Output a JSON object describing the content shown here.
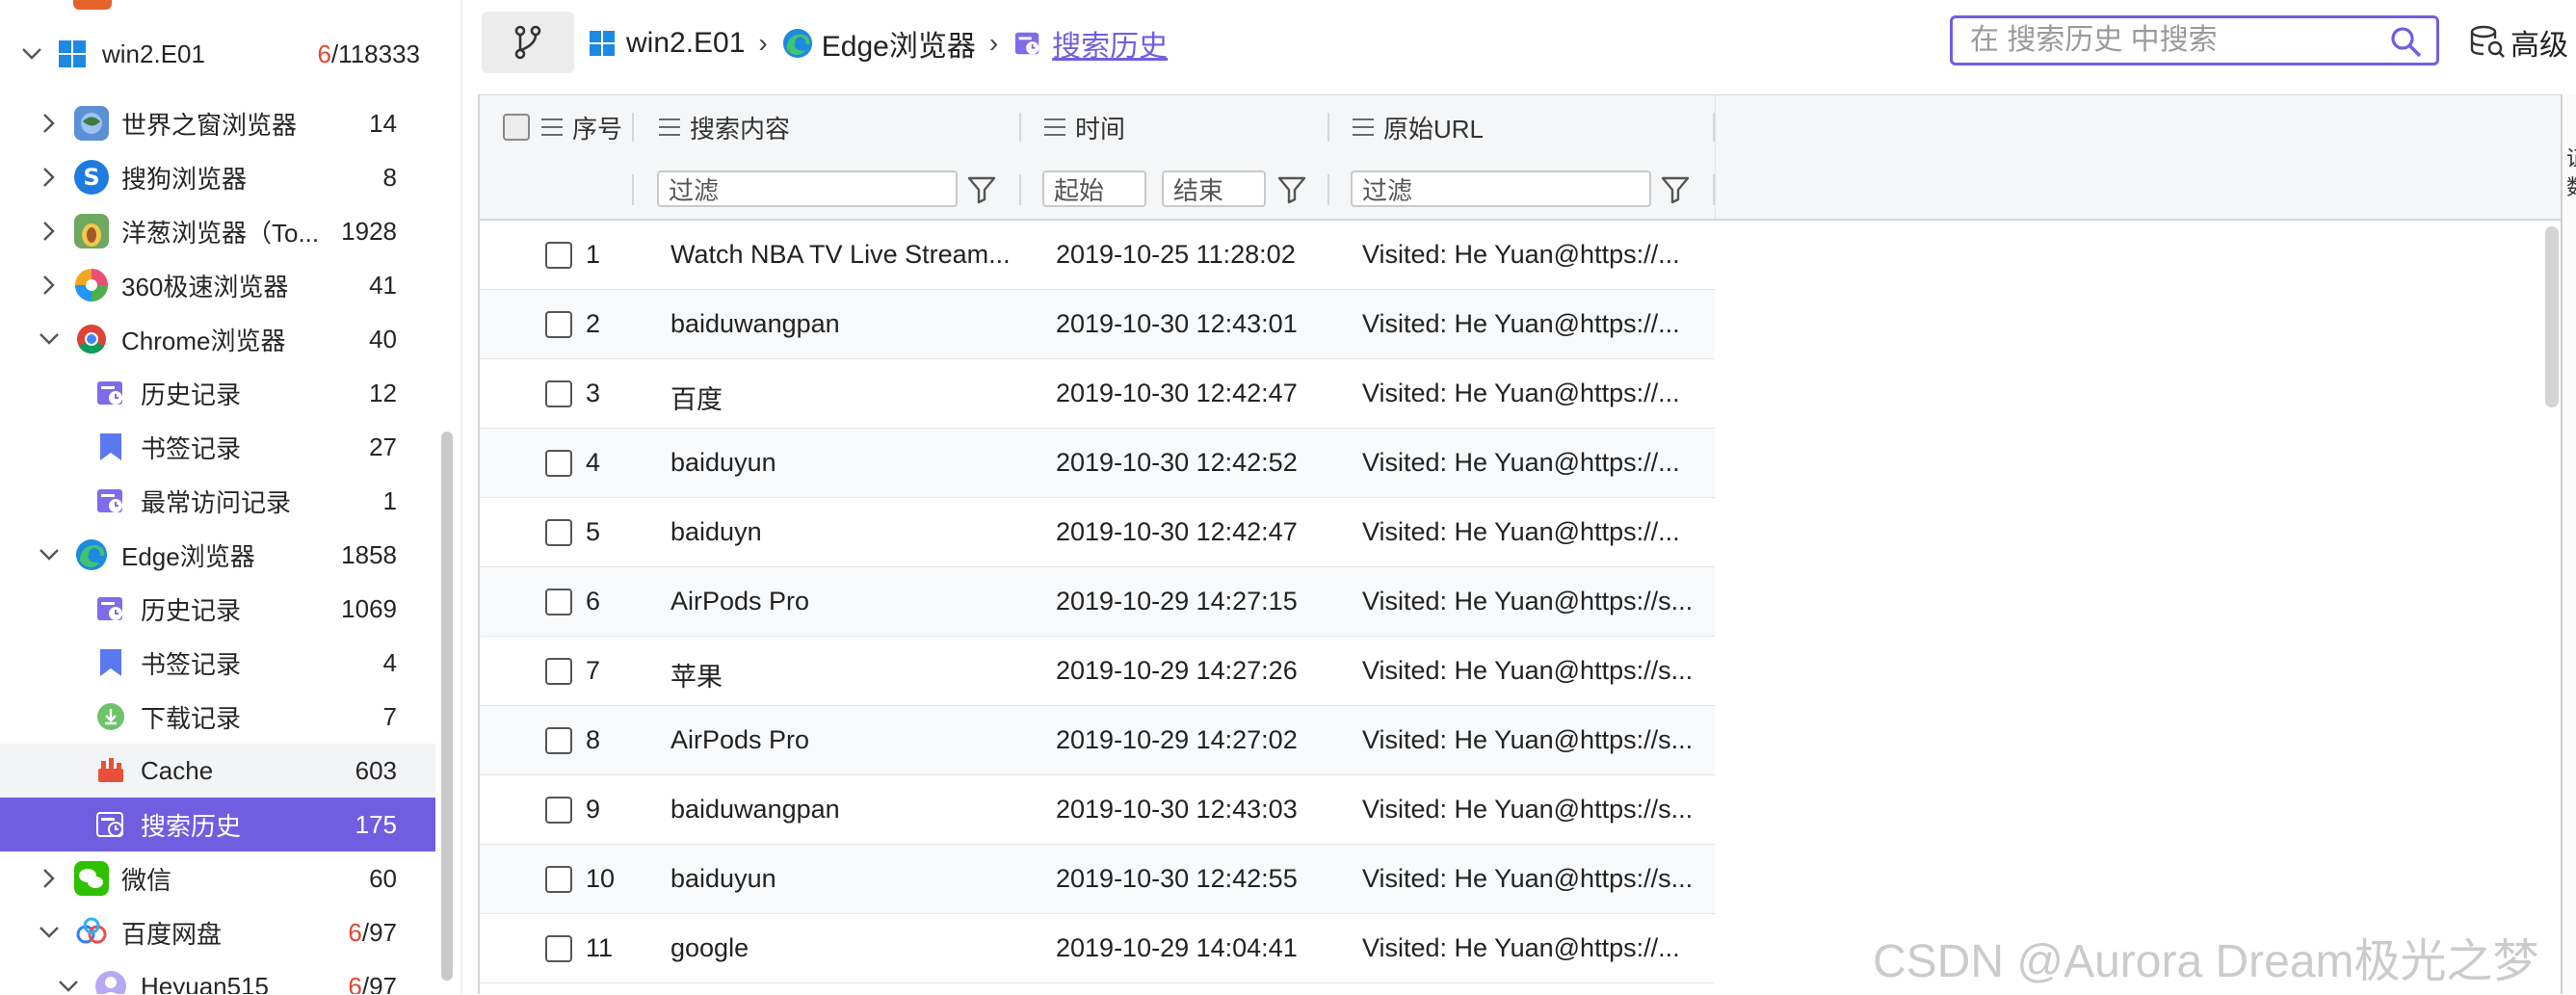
{
  "sidebar": {
    "items": [
      {
        "label": "win2.E01",
        "count_red": "6",
        "count_rest": "/118333"
      },
      {
        "label": "世界之窗浏览器",
        "count": "14"
      },
      {
        "label": "搜狗浏览器",
        "count": "8"
      },
      {
        "label": "洋葱浏览器（To...",
        "count": "1928"
      },
      {
        "label": "360极速浏览器",
        "count": "41"
      },
      {
        "label": "Chrome浏览器",
        "count": "40"
      },
      {
        "label": "历史记录",
        "count": "12"
      },
      {
        "label": "书签记录",
        "count": "27"
      },
      {
        "label": "最常访问记录",
        "count": "1"
      },
      {
        "label": "Edge浏览器",
        "count": "1858"
      },
      {
        "label": "历史记录",
        "count": "1069"
      },
      {
        "label": "书签记录",
        "count": "4"
      },
      {
        "label": "下载记录",
        "count": "7"
      },
      {
        "label": "Cache",
        "count": "603"
      },
      {
        "label": "搜索历史",
        "count": "175"
      },
      {
        "label": "微信",
        "count": "60"
      },
      {
        "label": "百度网盘",
        "count_red": "6",
        "count_rest": "/97"
      },
      {
        "label": "Heyuan515",
        "count_red": "6",
        "count_rest": "/97"
      }
    ]
  },
  "breadcrumb": {
    "root": "win2.E01",
    "browser": "Edge浏览器",
    "current": "搜索历史",
    "separator": "›"
  },
  "search": {
    "placeholder": "在 搜索历史 中搜索"
  },
  "advanced": {
    "label": "高级"
  },
  "grid": {
    "columns": {
      "index": "序号",
      "keyword": "搜索内容",
      "time": "时间",
      "url": "原始URL"
    },
    "filters": {
      "keyword_placeholder": "过滤",
      "time_start": "起始",
      "time_end": "结束",
      "url_placeholder": "过滤"
    },
    "rows": [
      {
        "index": "1",
        "keyword": "Watch NBA TV Live Stream...",
        "time": "2019-10-25 11:28:02",
        "url": "Visited: He Yuan@https://..."
      },
      {
        "index": "2",
        "keyword": "baiduwangpan",
        "time": "2019-10-30 12:43:01",
        "url": "Visited: He Yuan@https://..."
      },
      {
        "index": "3",
        "keyword": "百度",
        "time": "2019-10-30 12:42:47",
        "url": "Visited: He Yuan@https://..."
      },
      {
        "index": "4",
        "keyword": "baiduyun",
        "time": "2019-10-30 12:42:52",
        "url": "Visited: He Yuan@https://..."
      },
      {
        "index": "5",
        "keyword": "baiduyn",
        "time": "2019-10-30 12:42:47",
        "url": "Visited: He Yuan@https://..."
      },
      {
        "index": "6",
        "keyword": "AirPods Pro",
        "time": "2019-10-29 14:27:15",
        "url": "Visited: He Yuan@https://s..."
      },
      {
        "index": "7",
        "keyword": "苹果",
        "time": "2019-10-29 14:27:26",
        "url": "Visited: He Yuan@https://s..."
      },
      {
        "index": "8",
        "keyword": "AirPods Pro",
        "time": "2019-10-29 14:27:02",
        "url": "Visited: He Yuan@https://s..."
      },
      {
        "index": "9",
        "keyword": "baiduwangpan",
        "time": "2019-10-30 12:43:03",
        "url": "Visited: He Yuan@https://s..."
      },
      {
        "index": "10",
        "keyword": "baiduyun",
        "time": "2019-10-30 12:42:55",
        "url": "Visited: He Yuan@https://s..."
      },
      {
        "index": "11",
        "keyword": "google",
        "time": "2019-10-29 14:04:41",
        "url": "Visited: He Yuan@https://..."
      }
    ]
  },
  "right_panel": {
    "text": "证数"
  },
  "watermark": "CSDN @Aurora Dream极光之梦",
  "colors": {
    "accent": "#6f5fe0",
    "count_red": "#e0492f",
    "selected_bg": "#6f5fe0"
  },
  "icons": {
    "windows": "windows-logo-icon",
    "edge": "edge-browser-icon",
    "history": "history-icon",
    "bookmark": "bookmark-icon",
    "download": "download-icon",
    "cache": "cache-icon",
    "wechat": "wechat-icon",
    "baidu_netdisk": "baidu-netdisk-icon",
    "user": "user-avatar-icon",
    "search": "search-icon",
    "filter": "filter-icon",
    "branch": "branch-icon"
  }
}
